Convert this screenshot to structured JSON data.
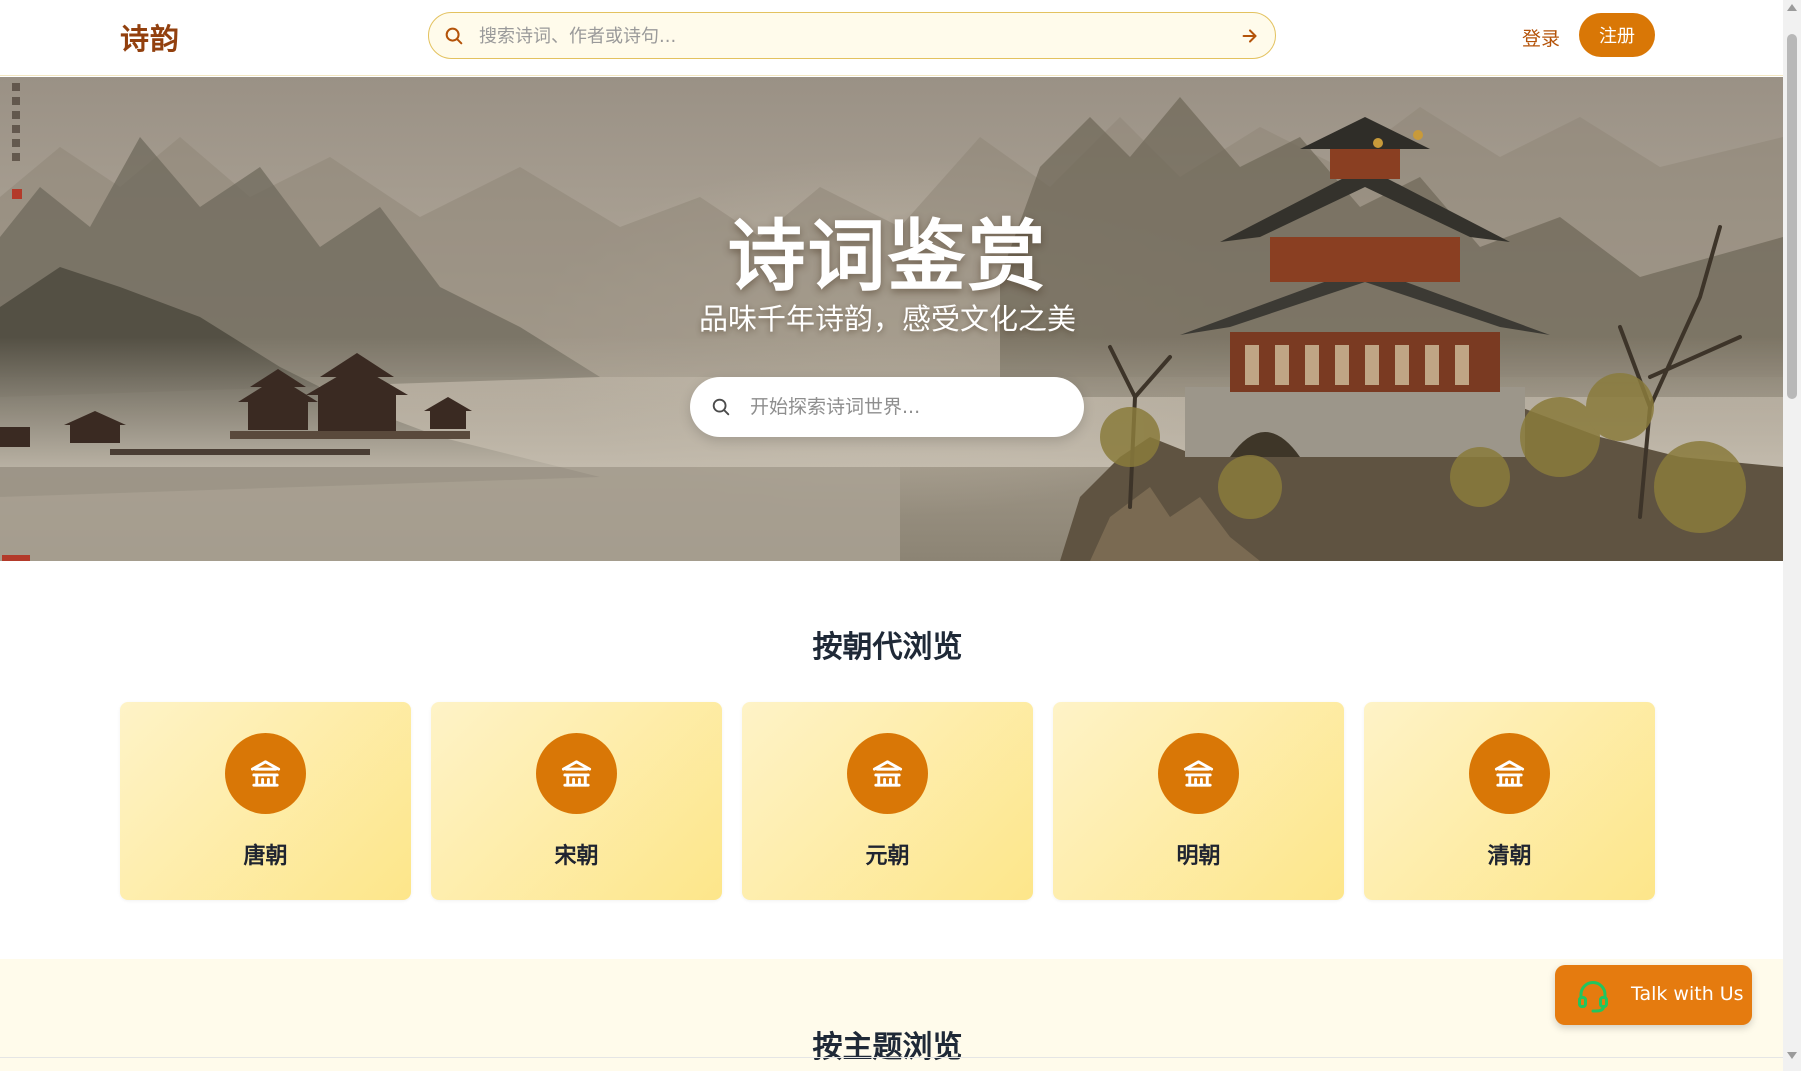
{
  "header": {
    "logo": "诗韵",
    "search_placeholder": "搜索诗词、作者或诗句...",
    "login_label": "登录",
    "register_label": "注册"
  },
  "hero": {
    "title": "诗词鉴赏",
    "subtitle": "品味千年诗韵，感受文化之美",
    "search_placeholder": "开始探索诗词世界..."
  },
  "dynasty_section": {
    "title": "按朝代浏览",
    "cards": [
      {
        "label": "唐朝",
        "icon": "pavilion-icon"
      },
      {
        "label": "宋朝",
        "icon": "pavilion-icon"
      },
      {
        "label": "元朝",
        "icon": "pavilion-icon"
      },
      {
        "label": "明朝",
        "icon": "pavilion-icon"
      },
      {
        "label": "清朝",
        "icon": "pavilion-icon"
      }
    ]
  },
  "theme_section": {
    "title": "按主题浏览"
  },
  "chat_widget": {
    "label": "Talk with Us",
    "icon": "headset-icon"
  },
  "colors": {
    "accent": "#d97706",
    "brand_text": "#92400e",
    "card_gradient_start": "#fef3c7",
    "card_gradient_end": "#fde68a",
    "theme_band": "#fffbeb"
  }
}
